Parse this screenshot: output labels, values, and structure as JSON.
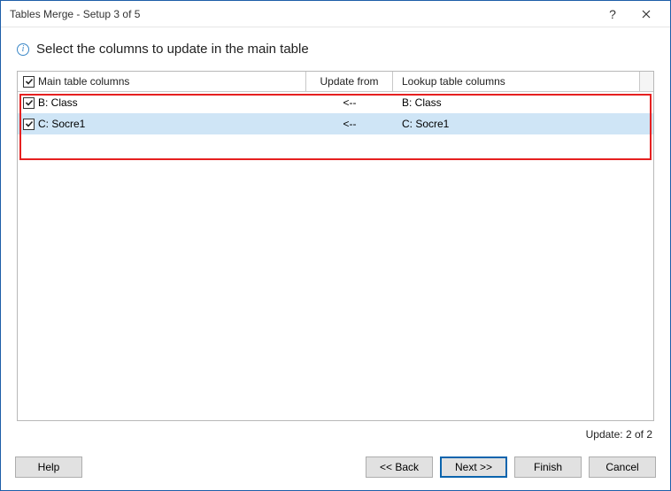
{
  "window": {
    "title": "Tables Merge - Setup 3 of 5"
  },
  "heading": "Select the columns to update in the main table",
  "columns": {
    "main": "Main table columns",
    "update": "Update from",
    "lookup": "Lookup table columns"
  },
  "rows": [
    {
      "main": "B: Class",
      "arrow": "<--",
      "lookup": "B: Class"
    },
    {
      "main": "C: Socre1",
      "arrow": "<--",
      "lookup": "C: Socre1"
    }
  ],
  "status": "Update: 2 of 2",
  "buttons": {
    "help": "Help",
    "back": "<< Back",
    "next": "Next >>",
    "finish": "Finish",
    "cancel": "Cancel"
  },
  "icons": {
    "info": "i"
  }
}
